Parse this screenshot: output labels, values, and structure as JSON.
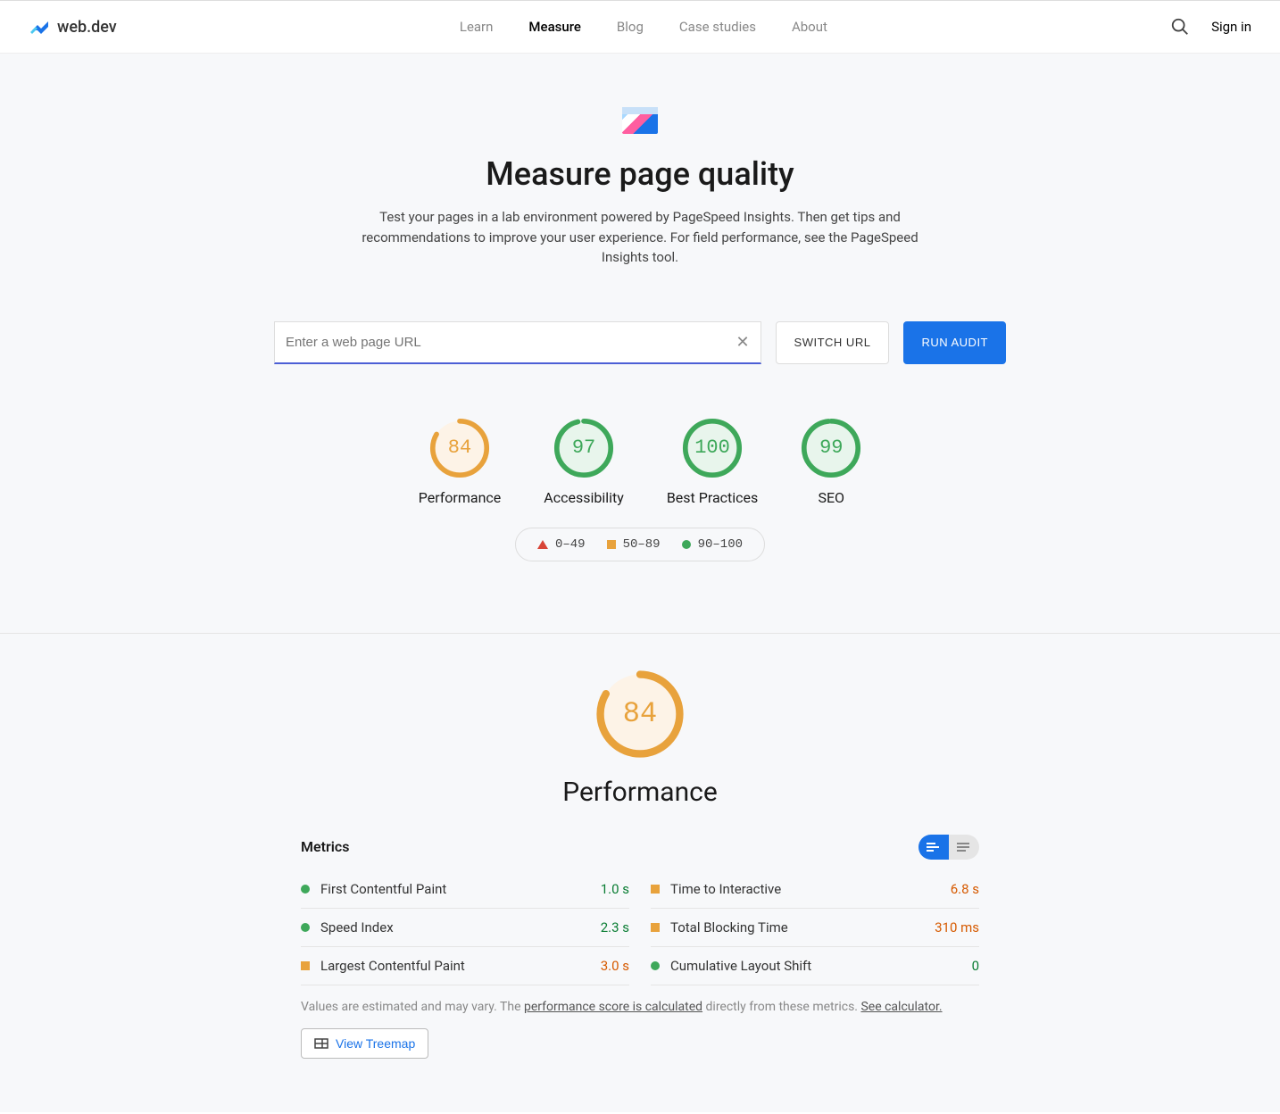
{
  "brand": "web.dev",
  "nav": {
    "learn": "Learn",
    "measure": "Measure",
    "blog": "Blog",
    "cases": "Case studies",
    "about": "About"
  },
  "signin": "Sign in",
  "hero": {
    "title": "Measure page quality",
    "subtitle": "Test your pages in a lab environment powered by PageSpeed Insights. Then get tips and recommendations to improve your user experience. For field performance, see the PageSpeed Insights tool."
  },
  "urlbar": {
    "placeholder": "Enter a web page URL",
    "switch": "SWITCH URL",
    "run": "RUN AUDIT"
  },
  "gauges": [
    {
      "score": "84",
      "label": "Performance",
      "color": "orange",
      "pct": 84
    },
    {
      "score": "97",
      "label": "Accessibility",
      "color": "green",
      "pct": 97
    },
    {
      "score": "100",
      "label": "Best Practices",
      "color": "green",
      "pct": 100
    },
    {
      "score": "99",
      "label": "SEO",
      "color": "green",
      "pct": 99
    }
  ],
  "legend": {
    "fail": "0–49",
    "avg": "50–89",
    "pass": "90–100"
  },
  "perf": {
    "score": "84",
    "title": "Performance",
    "metrics_label": "Metrics",
    "metrics": [
      {
        "name": "First Contentful Paint",
        "value": "1.0 s",
        "status": "green",
        "col": 0
      },
      {
        "name": "Time to Interactive",
        "value": "6.8 s",
        "status": "orange",
        "col": 1
      },
      {
        "name": "Speed Index",
        "value": "2.3 s",
        "status": "green",
        "col": 0
      },
      {
        "name": "Total Blocking Time",
        "value": "310 ms",
        "status": "orange",
        "col": 1
      },
      {
        "name": "Largest Contentful Paint",
        "value": "3.0 s",
        "status": "orange",
        "col": 0
      },
      {
        "name": "Cumulative Layout Shift",
        "value": "0",
        "status": "green",
        "col": 1
      }
    ],
    "footnote_pre": "Values are estimated and may vary. The ",
    "footnote_link1": "performance score is calculated",
    "footnote_mid": " directly from these metrics. ",
    "footnote_link2": "See calculator.",
    "treemap": "View Treemap"
  }
}
